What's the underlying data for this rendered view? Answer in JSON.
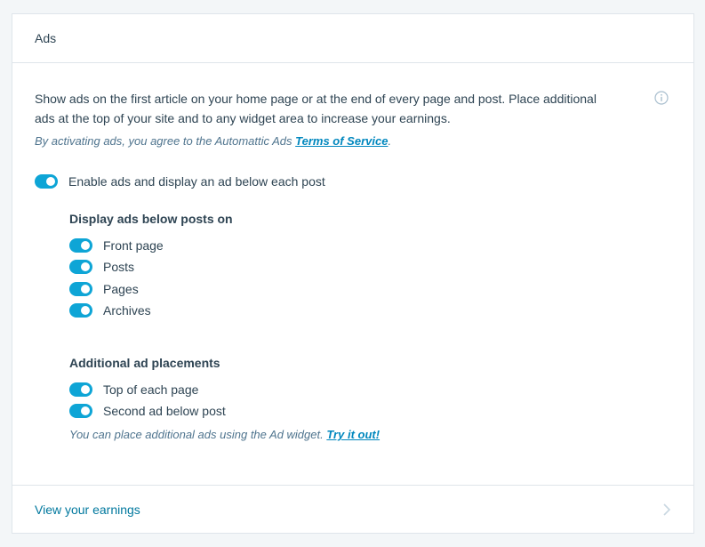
{
  "header": {
    "title": "Ads"
  },
  "description": "Show ads on the first article on your home page or at the end of every page and post. Place additional ads at the top of your site and to any widget area to increase your earnings.",
  "tos": {
    "prefix": "By activating ads, you agree to the Automattic Ads ",
    "link": "Terms of Service",
    "suffix": "."
  },
  "main_toggle": {
    "label": "Enable ads and display an ad below each post",
    "checked": true
  },
  "display_section": {
    "title": "Display ads below posts on",
    "items": [
      {
        "label": "Front page",
        "checked": true
      },
      {
        "label": "Posts",
        "checked": true
      },
      {
        "label": "Pages",
        "checked": true
      },
      {
        "label": "Archives",
        "checked": true
      }
    ]
  },
  "placements_section": {
    "title": "Additional ad placements",
    "items": [
      {
        "label": "Top of each page",
        "checked": true
      },
      {
        "label": "Second ad below post",
        "checked": true
      }
    ]
  },
  "hint": {
    "prefix": "You can place additional ads using the Ad widget. ",
    "link": "Try it out!"
  },
  "footer": {
    "label": "View your earnings"
  },
  "icons": {
    "info": "info-icon",
    "chevron": "chevron-right-icon"
  },
  "colors": {
    "accent": "#0ea5d6",
    "link": "#0087be",
    "text": "#2e4453",
    "muted": "#4f748e"
  }
}
